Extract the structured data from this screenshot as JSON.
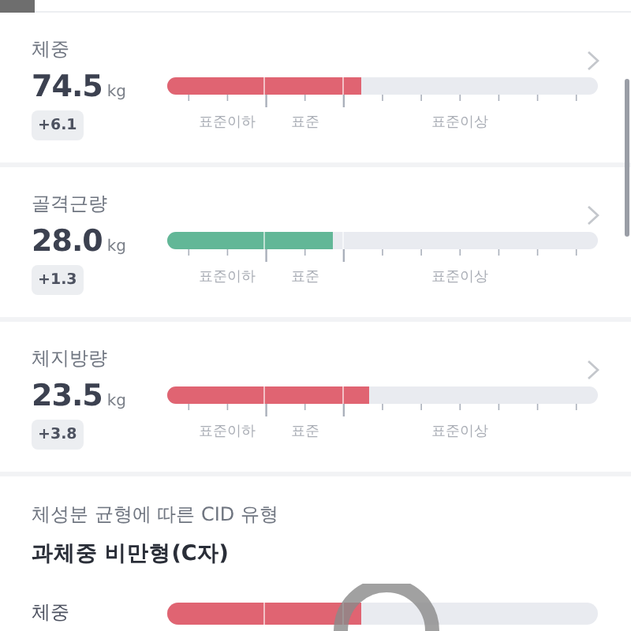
{
  "metrics": [
    {
      "name": "체중",
      "value": "74.5",
      "unit": "kg",
      "change": "+6.1",
      "level": 0.45,
      "color": "#e06472",
      "scale": [
        "표준이하",
        "표준",
        "표준이상"
      ]
    },
    {
      "name": "골격근량",
      "value": "28.0",
      "unit": "kg",
      "change": "+1.3",
      "level": 0.385,
      "color": "#62b797",
      "scale": [
        "표준이하",
        "표준",
        "표준이상"
      ]
    },
    {
      "name": "체지방량",
      "value": "23.5",
      "unit": "kg",
      "change": "+3.8",
      "level": 0.47,
      "color": "#e06472",
      "scale": [
        "표준이하",
        "표준",
        "표준이상"
      ]
    }
  ],
  "cid": {
    "caption": "체성분 균형에 따른 CID 유형",
    "type": "과체중 비만형(C자)",
    "rows": [
      {
        "name": "체중",
        "level": 0.45,
        "color": "#e06472"
      }
    ]
  }
}
